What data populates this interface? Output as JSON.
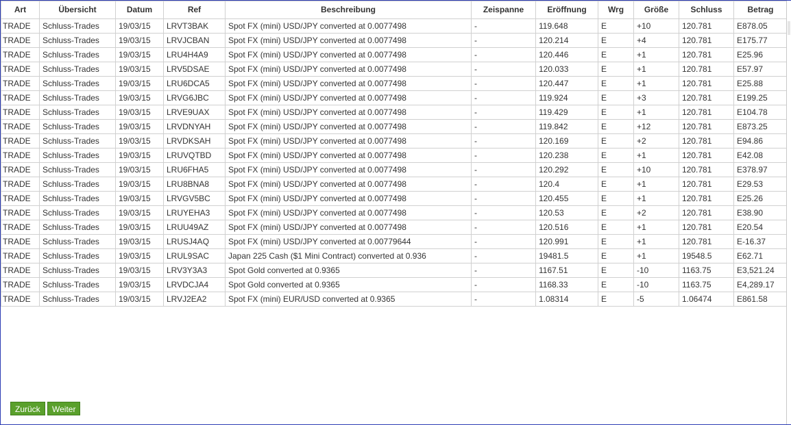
{
  "table": {
    "headers": [
      "Art",
      "Übersicht",
      "Datum",
      "Ref",
      "Beschreibung",
      "Zeispanne",
      "Eröffnung",
      "Wrg",
      "Größe",
      "Schluss",
      "Betrag"
    ],
    "rows": [
      [
        "TRADE",
        "Schluss-Trades",
        "19/03/15",
        "LRVT3BAK",
        "Spot FX (mini) USD/JPY converted at 0.0077498",
        "-",
        "119.648",
        "E",
        "+10",
        "120.781",
        "E878.05"
      ],
      [
        "TRADE",
        "Schluss-Trades",
        "19/03/15",
        "LRVJCBAN",
        "Spot FX (mini) USD/JPY converted at 0.0077498",
        "-",
        "120.214",
        "E",
        "+4",
        "120.781",
        "E175.77"
      ],
      [
        "TRADE",
        "Schluss-Trades",
        "19/03/15",
        "LRU4H4A9",
        "Spot FX (mini) USD/JPY converted at 0.0077498",
        "-",
        "120.446",
        "E",
        "+1",
        "120.781",
        "E25.96"
      ],
      [
        "TRADE",
        "Schluss-Trades",
        "19/03/15",
        "LRV5DSAE",
        "Spot FX (mini) USD/JPY converted at 0.0077498",
        "-",
        "120.033",
        "E",
        "+1",
        "120.781",
        "E57.97"
      ],
      [
        "TRADE",
        "Schluss-Trades",
        "19/03/15",
        "LRU6DCA5",
        "Spot FX (mini) USD/JPY converted at 0.0077498",
        "-",
        "120.447",
        "E",
        "+1",
        "120.781",
        "E25.88"
      ],
      [
        "TRADE",
        "Schluss-Trades",
        "19/03/15",
        "LRVG6JBC",
        "Spot FX (mini) USD/JPY converted at 0.0077498",
        "-",
        "119.924",
        "E",
        "+3",
        "120.781",
        "E199.25"
      ],
      [
        "TRADE",
        "Schluss-Trades",
        "19/03/15",
        "LRVE9UAX",
        "Spot FX (mini) USD/JPY converted at 0.0077498",
        "-",
        "119.429",
        "E",
        "+1",
        "120.781",
        "E104.78"
      ],
      [
        "TRADE",
        "Schluss-Trades",
        "19/03/15",
        "LRVDNYAH",
        "Spot FX (mini) USD/JPY converted at 0.0077498",
        "-",
        "119.842",
        "E",
        "+12",
        "120.781",
        "E873.25"
      ],
      [
        "TRADE",
        "Schluss-Trades",
        "19/03/15",
        "LRVDKSAH",
        "Spot FX (mini) USD/JPY converted at 0.0077498",
        "-",
        "120.169",
        "E",
        "+2",
        "120.781",
        "E94.86"
      ],
      [
        "TRADE",
        "Schluss-Trades",
        "19/03/15",
        "LRUVQTBD",
        "Spot FX (mini) USD/JPY converted at 0.0077498",
        "-",
        "120.238",
        "E",
        "+1",
        "120.781",
        "E42.08"
      ],
      [
        "TRADE",
        "Schluss-Trades",
        "19/03/15",
        "LRU6FHA5",
        "Spot FX (mini) USD/JPY converted at 0.0077498",
        "-",
        "120.292",
        "E",
        "+10",
        "120.781",
        "E378.97"
      ],
      [
        "TRADE",
        "Schluss-Trades",
        "19/03/15",
        "LRU8BNA8",
        "Spot FX (mini) USD/JPY converted at 0.0077498",
        "-",
        "120.4",
        "E",
        "+1",
        "120.781",
        "E29.53"
      ],
      [
        "TRADE",
        "Schluss-Trades",
        "19/03/15",
        "LRVGV5BC",
        "Spot FX (mini) USD/JPY converted at 0.0077498",
        "-",
        "120.455",
        "E",
        "+1",
        "120.781",
        "E25.26"
      ],
      [
        "TRADE",
        "Schluss-Trades",
        "19/03/15",
        "LRUYEHA3",
        "Spot FX (mini) USD/JPY converted at 0.0077498",
        "-",
        "120.53",
        "E",
        "+2",
        "120.781",
        "E38.90"
      ],
      [
        "TRADE",
        "Schluss-Trades",
        "19/03/15",
        "LRUU49AZ",
        "Spot FX (mini) USD/JPY converted at 0.0077498",
        "-",
        "120.516",
        "E",
        "+1",
        "120.781",
        "E20.54"
      ],
      [
        "TRADE",
        "Schluss-Trades",
        "19/03/15",
        "LRUSJ4AQ",
        "Spot FX (mini) USD/JPY converted at 0.00779644",
        "-",
        "120.991",
        "E",
        "+1",
        "120.781",
        "E-16.37"
      ],
      [
        "TRADE",
        "Schluss-Trades",
        "19/03/15",
        "LRUL9SAC",
        "Japan 225 Cash ($1 Mini Contract) converted at 0.936",
        "-",
        "19481.5",
        "E",
        "+1",
        "19548.5",
        "E62.71"
      ],
      [
        "TRADE",
        "Schluss-Trades",
        "19/03/15",
        "LRV3Y3A3",
        "Spot Gold converted at 0.9365",
        "-",
        "1167.51",
        "E",
        "-10",
        "1163.75",
        "E3,521.24"
      ],
      [
        "TRADE",
        "Schluss-Trades",
        "19/03/15",
        "LRVDCJA4",
        "Spot Gold converted at 0.9365",
        "-",
        "1168.33",
        "E",
        "-10",
        "1163.75",
        "E4,289.17"
      ],
      [
        "TRADE",
        "Schluss-Trades",
        "19/03/15",
        "LRVJ2EA2",
        "Spot FX (mini) EUR/USD converted at 0.9365",
        "-",
        "1.08314",
        "E",
        "-5",
        "1.06474",
        "E861.58"
      ]
    ]
  },
  "pagination": {
    "back_label": "Zurück",
    "next_label": "Weiter"
  },
  "colors": {
    "button_bg": "#5aa02c",
    "frame_border": "#2b3bb3",
    "grid_line": "#d0d0d0"
  }
}
